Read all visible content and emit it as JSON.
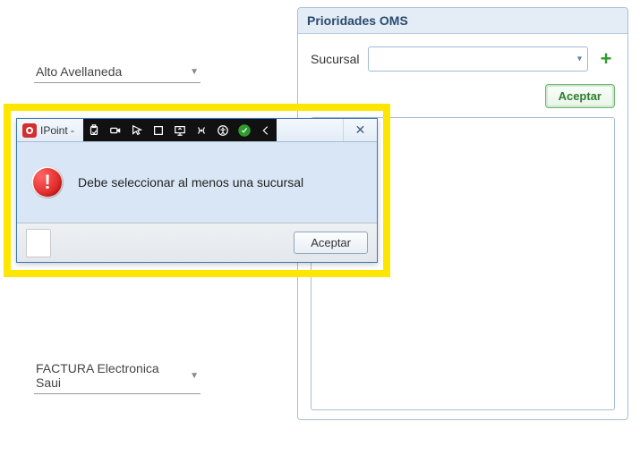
{
  "dropdowns": {
    "branch": "Alto Avellaneda",
    "invoice_type": "FACTURA Electronica Saui"
  },
  "panel": {
    "title": "Prioridades OMS",
    "sucursal_label": "Sucursal",
    "accept_label": "Aceptar"
  },
  "modal": {
    "app_name": "IPoint -",
    "message": "Debe seleccionar al menos una sucursal",
    "accept_label": "Aceptar"
  }
}
